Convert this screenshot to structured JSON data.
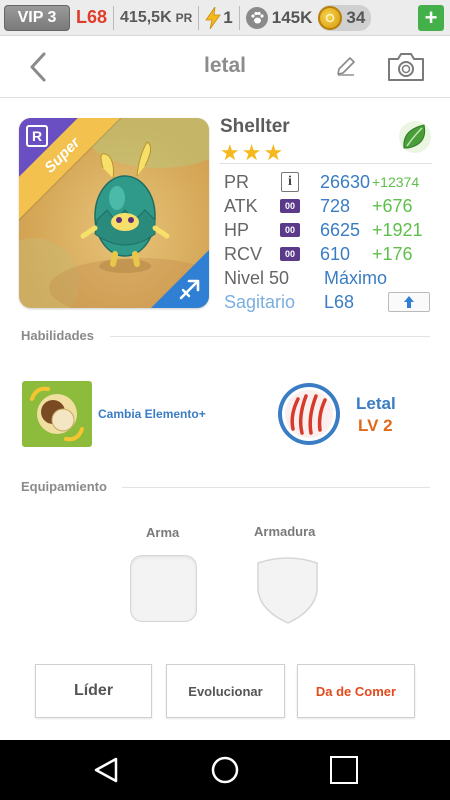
{
  "statusbar": {
    "vip": "VIP 3",
    "level": "L68",
    "power_value": "415,5K",
    "power_unit": "PR",
    "energy": "1",
    "pet_food": "145K",
    "coins": "34",
    "plus": "+"
  },
  "header": {
    "title": "letal"
  },
  "monster": {
    "ribbon": "Super",
    "rarity_badge": "R",
    "name": "Shellter",
    "stars": "★★★",
    "stats": {
      "pr": {
        "label": "PR",
        "value": "26630",
        "bonus": "+12374"
      },
      "atk": {
        "label": "ATK",
        "value": "728",
        "bonus": "+676",
        "tag": "00"
      },
      "hp": {
        "label": "HP",
        "value": "6625",
        "bonus": "+1921",
        "tag": "00"
      },
      "rcv": {
        "label": "RCV",
        "value": "610",
        "bonus": "+176",
        "tag": "00"
      },
      "level": {
        "label": "Nivel 50",
        "value": "Máximo"
      },
      "sign": {
        "label": "Sagitario",
        "value": "L68"
      }
    }
  },
  "habilidades": {
    "title": "Habilidades",
    "skill_name": "Cambia Elemento+",
    "passive_name": "Letal",
    "passive_level": "LV 2"
  },
  "equipamiento": {
    "title": "Equipamiento",
    "weapon_label": "Arma",
    "armor_label": "Armadura"
  },
  "actions": {
    "leader": "Líder",
    "evolve": "Evolucionar",
    "feed": "Da de Comer"
  },
  "colors": {
    "accent_blue": "#3a7dc4",
    "bonus_green": "#5fbf4a",
    "feed_orange": "#e04a1c",
    "ribbon_gold": "#f2c14e",
    "rarity_purple": "#6a4fc2"
  }
}
